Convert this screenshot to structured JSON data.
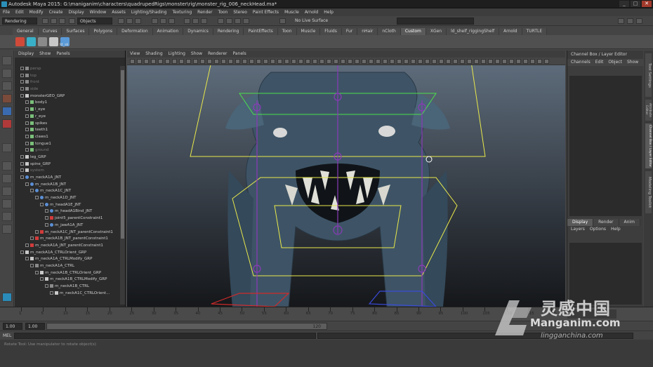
{
  "window": {
    "title": "Autodesk Maya 2015: G:\\maniganim\\characters\\quadrupedRigs\\monster\\rig\\monster_rig_006_neckHead.ma*",
    "buttons": [
      "_",
      "□",
      "✕"
    ]
  },
  "menubar": [
    "File",
    "Edit",
    "Modify",
    "Create",
    "Display",
    "Window",
    "Assets",
    "Lighting/Shading",
    "Texturing",
    "Render",
    "Toon",
    "Stereo",
    "Paint Effects",
    "Muscle",
    "Arnold",
    "Help"
  ],
  "statusline": {
    "menu_set": "Rendering",
    "selection_field": "Objects",
    "live_surface": "No Live Surface"
  },
  "shelf": {
    "tabs": [
      "General",
      "Curves",
      "Surfaces",
      "Polygons",
      "Deformation",
      "Animation",
      "Dynamics",
      "Rendering",
      "PaintEffects",
      "Toon",
      "Muscle",
      "Fluids",
      "Fur",
      "nHair",
      "nCloth",
      "Custom",
      "XGen",
      "ld_shelf_riggingShelf",
      "Arnold",
      "TURTLE"
    ],
    "active_tab": "Custom",
    "items": [
      {
        "icon": "joint-tool-icon",
        "color": "#d04a3a"
      },
      {
        "icon": "ik-handle-icon",
        "color": "#3ab0c8"
      },
      {
        "icon": "script-icon",
        "color": "#8a8a8a"
      },
      {
        "icon": "constraint-icon",
        "color": "#c8c8c8"
      },
      {
        "icon": "rig-icon",
        "color": "#5a9ad8"
      }
    ],
    "item_label": "ld_sk"
  },
  "outliner": {
    "menu": [
      "Display",
      "Show",
      "Panels"
    ],
    "rows": [
      {
        "label": "persp",
        "kind": "cam",
        "depth": 0,
        "dim": true
      },
      {
        "label": "top",
        "kind": "cam",
        "depth": 0,
        "dim": true
      },
      {
        "label": "front",
        "kind": "cam",
        "depth": 0,
        "dim": true
      },
      {
        "label": "side",
        "kind": "cam",
        "depth": 0,
        "dim": true
      },
      {
        "label": "monsterGEO_GRP",
        "kind": "grp",
        "depth": 0,
        "dim": false
      },
      {
        "label": "body1",
        "kind": "mesh",
        "depth": 1,
        "dim": false
      },
      {
        "label": "l_eye",
        "kind": "mesh",
        "depth": 1,
        "dim": false
      },
      {
        "label": "r_eye",
        "kind": "mesh",
        "depth": 1,
        "dim": false
      },
      {
        "label": "spikes",
        "kind": "mesh",
        "depth": 1,
        "dim": false
      },
      {
        "label": "teeth1",
        "kind": "mesh",
        "depth": 1,
        "dim": false
      },
      {
        "label": "claws1",
        "kind": "mesh",
        "depth": 1,
        "dim": false
      },
      {
        "label": "tongue1",
        "kind": "mesh",
        "depth": 1,
        "dim": false
      },
      {
        "label": "ground",
        "kind": "mesh",
        "depth": 1,
        "dim": true
      },
      {
        "label": "leg_GRP",
        "kind": "grp",
        "depth": 0,
        "dim": false
      },
      {
        "label": "spine_GRP",
        "kind": "grp",
        "depth": 0,
        "dim": false
      },
      {
        "label": "system",
        "kind": "grp",
        "depth": 0,
        "dim": true
      },
      {
        "label": "m_neckA1A_JNT",
        "kind": "joint",
        "depth": 0,
        "dim": false
      },
      {
        "label": "m_neckA1B_JNT",
        "kind": "joint",
        "depth": 1,
        "dim": false
      },
      {
        "label": "m_neckA1C_JNT",
        "kind": "joint",
        "depth": 2,
        "dim": false
      },
      {
        "label": "m_neckA1D_JNT",
        "kind": "joint",
        "depth": 3,
        "dim": false
      },
      {
        "label": "m_headA1E_JNT",
        "kind": "joint",
        "depth": 4,
        "dim": false
      },
      {
        "label": "m_headA1Bind_JNT",
        "kind": "joint",
        "depth": 5,
        "dim": false
      },
      {
        "label": "joint5_parentConstraint1",
        "kind": "con",
        "depth": 5,
        "dim": false
      },
      {
        "label": "m_jawA1A_JNT",
        "kind": "joint",
        "depth": 5,
        "dim": false
      },
      {
        "label": "m_neckA1C_JNT_parentConstraint1",
        "kind": "con",
        "depth": 3,
        "dim": false
      },
      {
        "label": "m_neckA1B_JNT_parentConstraint1",
        "kind": "con",
        "depth": 2,
        "dim": false
      },
      {
        "label": "m_neckA1A_JNT_parentConstraint1",
        "kind": "con",
        "depth": 1,
        "dim": false
      },
      {
        "label": "m_neckA1A_CTRLOrient_GRP",
        "kind": "grp",
        "depth": 0,
        "dim": false
      },
      {
        "label": "m_neckA1A_CTRLModify_GRP",
        "kind": "grp",
        "depth": 1,
        "dim": false
      },
      {
        "label": "m_neckA1A_CTRL",
        "kind": "ctrl",
        "depth": 2,
        "dim": false
      },
      {
        "label": "m_neckA1B_CTRLOrient_GRP",
        "kind": "grp",
        "depth": 3,
        "dim": false
      },
      {
        "label": "m_neckA1B_CTRLModify_GRP",
        "kind": "grp",
        "depth": 4,
        "dim": false
      },
      {
        "label": "m_neckA1B_CTRL",
        "kind": "ctrl",
        "depth": 5,
        "dim": false
      },
      {
        "label": "m_neckA1C_CTRLOrient...",
        "kind": "grp",
        "depth": 6,
        "dim": false
      }
    ]
  },
  "viewport": {
    "menu": [
      "View",
      "Shading",
      "Lighting",
      "Show",
      "Renderer",
      "Panels"
    ],
    "colors": {
      "creature": "#3e5466",
      "control_yellow": "#e8e84a",
      "control_green": "#4ae04a",
      "joint_purple": "#8a3ab8",
      "control_red": "#d02a2a",
      "control_blue": "#3a4ad8"
    }
  },
  "channel_box": {
    "title": "Channel Box / Layer Editor",
    "menu": [
      "Channels",
      "Edit",
      "Object",
      "Show"
    ]
  },
  "layer_editor": {
    "tabs": [
      "Display",
      "Render",
      "Anim"
    ],
    "active_tab": "Display",
    "menu": [
      "Layers",
      "Options",
      "Help"
    ]
  },
  "side_tabs": [
    "Tool Settings",
    "Attribute Editor",
    "Channel Box / Layer Editor",
    "Modeling Toolkit"
  ],
  "timeline": {
    "labels": [
      "1",
      "5",
      "10",
      "15",
      "20",
      "25",
      "30",
      "35",
      "40",
      "45",
      "50",
      "55",
      "60",
      "65",
      "70",
      "75",
      "80",
      "85",
      "90",
      "95",
      "100",
      "105",
      "110",
      "115",
      "120"
    ]
  },
  "range": {
    "start": "1.00",
    "start2": "1.00",
    "end_value": "120"
  },
  "command_line": {
    "label": "MEL"
  },
  "help_line": "Rotate Tool: Use manipulator to rotate object(s)",
  "watermark": {
    "cn": "灵感中国",
    "en": "Manganim.com",
    "url": "lingganchina.com"
  }
}
